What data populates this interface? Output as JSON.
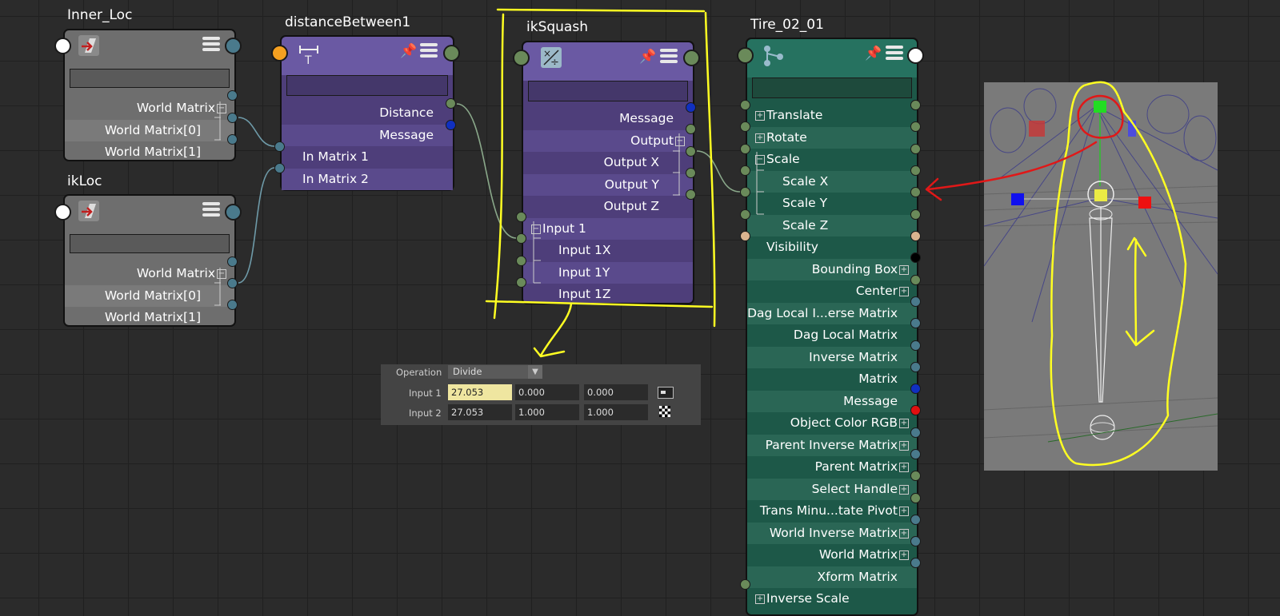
{
  "nodes": {
    "inner_loc": {
      "title": "Inner_Loc",
      "attrs": [
        "World Matrix",
        "World Matrix[0]",
        "World Matrix[1]"
      ]
    },
    "ik_loc": {
      "title": "ikLoc",
      "attrs": [
        "World Matrix",
        "World Matrix[0]",
        "World Matrix[1]"
      ]
    },
    "distance_between": {
      "title": "distanceBetween1",
      "attrs": [
        "Distance",
        "Message",
        "In Matrix 1",
        "In Matrix 2"
      ]
    },
    "ik_squash": {
      "title": "ikSquash",
      "attrs": [
        "Message",
        "Output",
        "Output X",
        "Output Y",
        "Output Z",
        "Input 1",
        "Input 1X",
        "Input 1Y",
        "Input 1Z"
      ]
    },
    "tire": {
      "title": "Tire_02_01",
      "attrs": [
        "Translate",
        "Rotate",
        "Scale",
        "Scale X",
        "Scale Y",
        "Scale Z",
        "Visibility",
        "Bounding Box",
        "Center",
        "Dag Local I...erse Matrix",
        "Dag Local Matrix",
        "Inverse Matrix",
        "Matrix",
        "Message",
        "Object Color RGB",
        "Parent Inverse Matrix",
        "Parent Matrix",
        "Select Handle",
        "Trans Minu...tate Pivot",
        "World Inverse Matrix",
        "World Matrix",
        "Xform Matrix",
        "Inverse Scale"
      ]
    }
  },
  "attribute_editor": {
    "operation_label": "Operation",
    "operation_value": "Divide",
    "input1_label": "Input 1",
    "input1_values": [
      "27.053",
      "0.000",
      "0.000"
    ],
    "input2_label": "Input 2",
    "input2_values": [
      "27.053",
      "1.000",
      "1.000"
    ]
  },
  "colors": {
    "connection_line": "#7f9a8a",
    "annotation_yellow": "#ffff00",
    "annotation_red": "#e02020",
    "port_teal": "#4a7a8c",
    "port_green": "#6a8a5a",
    "port_blue": "#1030c0"
  }
}
